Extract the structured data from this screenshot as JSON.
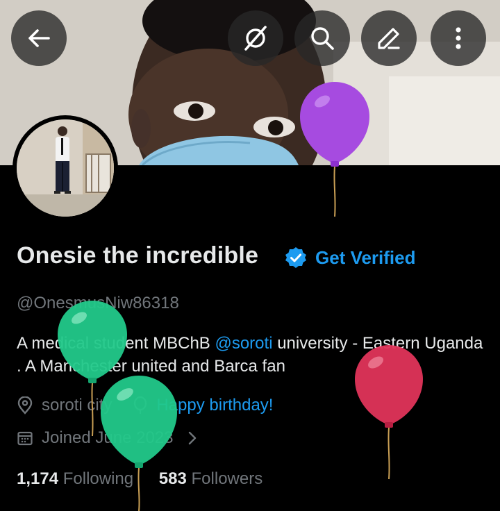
{
  "header": {
    "back_icon": "arrow-left-icon",
    "grok_icon": "grok-icon",
    "search_icon": "search-icon",
    "edit_icon": "pencil-icon",
    "more_icon": "more-vertical-icon"
  },
  "profile": {
    "display_name": "Onesie the incredible",
    "get_verified_label": "Get Verified",
    "handle": "@OnesmusNiw86318",
    "bio_part1": "A medical student MBChB ",
    "bio_mention": "@soroti",
    "bio_part2": " university - Eastern Uganda . A Manchester united and Barca fan",
    "location": "soroti city",
    "birthday": "Happy birthday!",
    "joined": "Joined June 2023",
    "following_count": "1,174",
    "following_label": "Following",
    "followers_count": "583",
    "followers_label": "Followers"
  },
  "colors": {
    "accent": "#1d9bf0",
    "background": "#000000",
    "secondary_text": "#71767b",
    "balloon_purple": "#a64be0",
    "balloon_green": "#22c98a",
    "balloon_red": "#e0345a"
  }
}
